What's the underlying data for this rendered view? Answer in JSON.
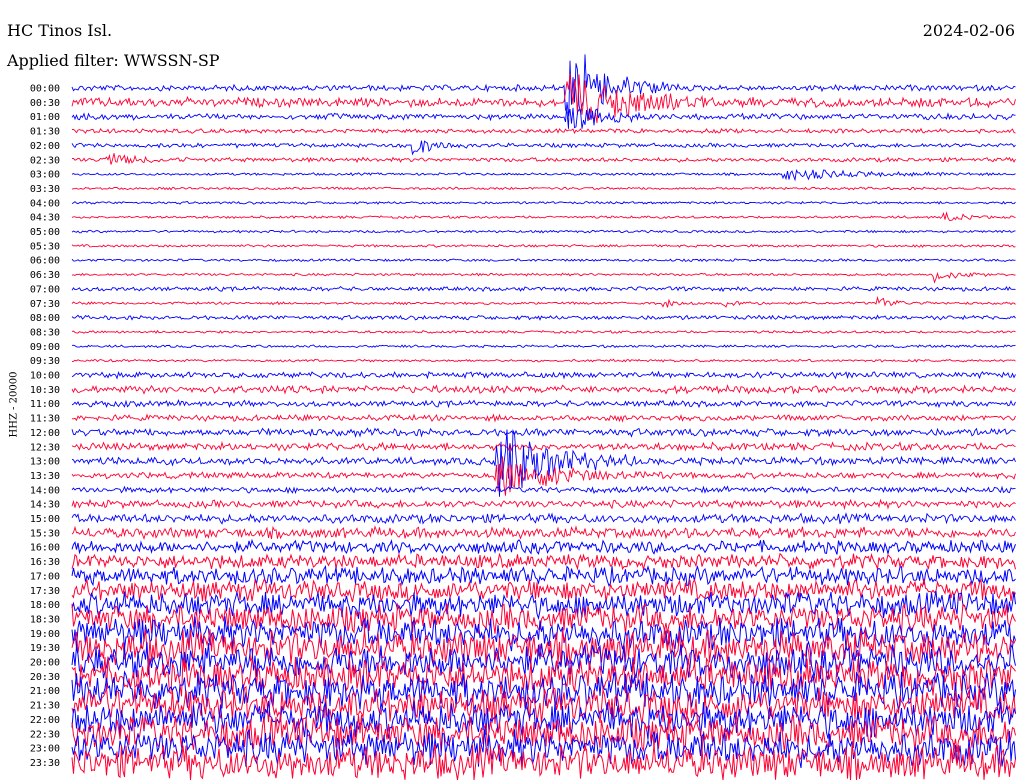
{
  "header": {
    "station": "HC Tinos Isl.",
    "date": "2024-02-06",
    "filter": "Applied filter: WWSSN-SP",
    "channel": "HHZ - 20000"
  },
  "colors": {
    "trace_a": "#0000ff",
    "trace_b": "#ff0033"
  },
  "chart_data": {
    "type": "line",
    "title": "HC Tinos Isl.",
    "subtitle": "Applied filter: WWSSN-SP",
    "ylabel": "HHZ - 20000",
    "x_minutes": [
      0,
      30
    ],
    "row_interval_minutes": 30,
    "row_labels": [
      "00:00",
      "00:30",
      "01:00",
      "01:30",
      "02:00",
      "02:30",
      "03:00",
      "03:30",
      "04:00",
      "04:30",
      "05:00",
      "05:30",
      "06:00",
      "06:30",
      "07:00",
      "07:30",
      "08:00",
      "08:30",
      "09:00",
      "09:30",
      "10:00",
      "10:30",
      "11:00",
      "11:30",
      "12:00",
      "12:30",
      "13:00",
      "13:30",
      "14:00",
      "14:30",
      "15:00",
      "15:30",
      "16:00",
      "16:30",
      "17:00",
      "17:30",
      "18:00",
      "18:30",
      "19:00",
      "19:30",
      "20:00",
      "20:30",
      "21:00",
      "21:30",
      "22:00",
      "22:30",
      "23:00",
      "23:30"
    ],
    "noise_level": [
      3,
      5,
      3,
      2,
      2,
      2,
      1,
      1,
      1,
      1,
      1,
      1,
      1,
      1,
      2,
      1,
      2,
      1,
      1,
      1,
      3,
      4,
      3,
      3,
      4,
      4,
      4,
      3,
      3,
      4,
      5,
      6,
      7,
      8,
      10,
      12,
      14,
      16,
      18,
      20,
      20,
      20,
      20,
      20,
      20,
      20,
      20,
      20
    ],
    "events": [
      {
        "row": 0,
        "minute": 15.7,
        "amp": 55,
        "dur": 1.2
      },
      {
        "row": 1,
        "minute": 15.7,
        "amp": 40,
        "dur": 1.5
      },
      {
        "row": 2,
        "minute": 15.7,
        "amp": 18,
        "dur": 1.0
      },
      {
        "row": 4,
        "minute": 10.8,
        "amp": 10,
        "dur": 0.6
      },
      {
        "row": 5,
        "minute": 1.1,
        "amp": 8,
        "dur": 0.8
      },
      {
        "row": 6,
        "minute": 22.6,
        "amp": 7,
        "dur": 2.0
      },
      {
        "row": 9,
        "minute": 27.7,
        "amp": 6,
        "dur": 0.5
      },
      {
        "row": 13,
        "minute": 27.4,
        "amp": 9,
        "dur": 0.6
      },
      {
        "row": 15,
        "minute": 18.8,
        "amp": 5,
        "dur": 0.4
      },
      {
        "row": 15,
        "minute": 20.7,
        "amp": 6,
        "dur": 0.5
      },
      {
        "row": 15,
        "minute": 25.6,
        "amp": 7,
        "dur": 0.6
      },
      {
        "row": 26,
        "minute": 13.5,
        "amp": 50,
        "dur": 1.5
      },
      {
        "row": 27,
        "minute": 13.5,
        "amp": 25,
        "dur": 1.8
      }
    ]
  }
}
